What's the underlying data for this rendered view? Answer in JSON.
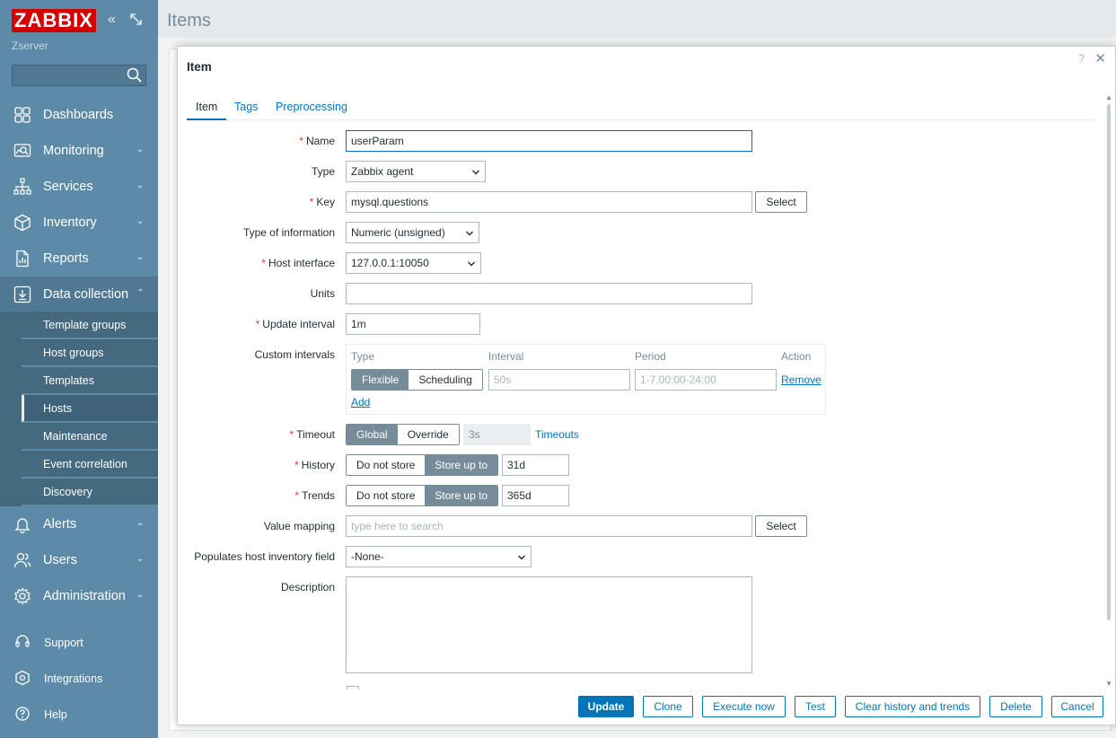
{
  "app": {
    "logo": "ZABBIX",
    "server": "Zserver"
  },
  "page": {
    "title": "Items"
  },
  "sidebar": {
    "items": [
      {
        "label": "Dashboards"
      },
      {
        "label": "Monitoring"
      },
      {
        "label": "Services"
      },
      {
        "label": "Inventory"
      },
      {
        "label": "Reports"
      },
      {
        "label": "Data collection"
      },
      {
        "label": "Alerts"
      },
      {
        "label": "Users"
      },
      {
        "label": "Administration"
      }
    ],
    "subitems": [
      {
        "label": "Template groups"
      },
      {
        "label": "Host groups"
      },
      {
        "label": "Templates"
      },
      {
        "label": "Hosts"
      },
      {
        "label": "Maintenance"
      },
      {
        "label": "Event correlation"
      },
      {
        "label": "Discovery"
      }
    ],
    "footer": [
      {
        "label": "Support"
      },
      {
        "label": "Integrations"
      },
      {
        "label": "Help"
      }
    ]
  },
  "modal": {
    "title": "Item",
    "help": "?",
    "close": "✕",
    "tabs": [
      "Item",
      "Tags",
      "Preprocessing"
    ],
    "labels": {
      "name": "Name",
      "type": "Type",
      "key": "Key",
      "type_of_information": "Type of information",
      "host_interface": "Host interface",
      "units": "Units",
      "update_interval": "Update interval",
      "custom_intervals": "Custom intervals",
      "timeout": "Timeout",
      "history": "History",
      "trends": "Trends",
      "value_mapping": "Value mapping",
      "inventory_field": "Populates host inventory field",
      "description": "Description"
    },
    "required_mark": "*",
    "values": {
      "name": "userParam",
      "type": "Zabbix agent",
      "key": "mysql.questions",
      "type_of_information": "Numeric (unsigned)",
      "host_interface": "127.0.0.1:10050",
      "units": "",
      "update_interval": "1m",
      "timeout": "3s",
      "history": "31d",
      "trends": "365d",
      "value_mapping_placeholder": "type here to search",
      "inventory_field": "-None-"
    },
    "select_button": "Select",
    "custom_intervals": {
      "headers": [
        "Type",
        "Interval",
        "Period",
        "Action"
      ],
      "type_options": [
        "Flexible",
        "Scheduling"
      ],
      "interval_placeholder": "50s",
      "period_placeholder": "1-7,00:00-24:00",
      "remove": "Remove",
      "add": "Add"
    },
    "timeout_options": [
      "Global",
      "Override"
    ],
    "timeouts_link": "Timeouts",
    "storage_options": [
      "Do not store",
      "Store up to"
    ],
    "buttons": {
      "update": "Update",
      "clone": "Clone",
      "execute_now": "Execute now",
      "test": "Test",
      "clear_history": "Clear history and trends",
      "delete": "Delete",
      "cancel": "Cancel"
    }
  }
}
